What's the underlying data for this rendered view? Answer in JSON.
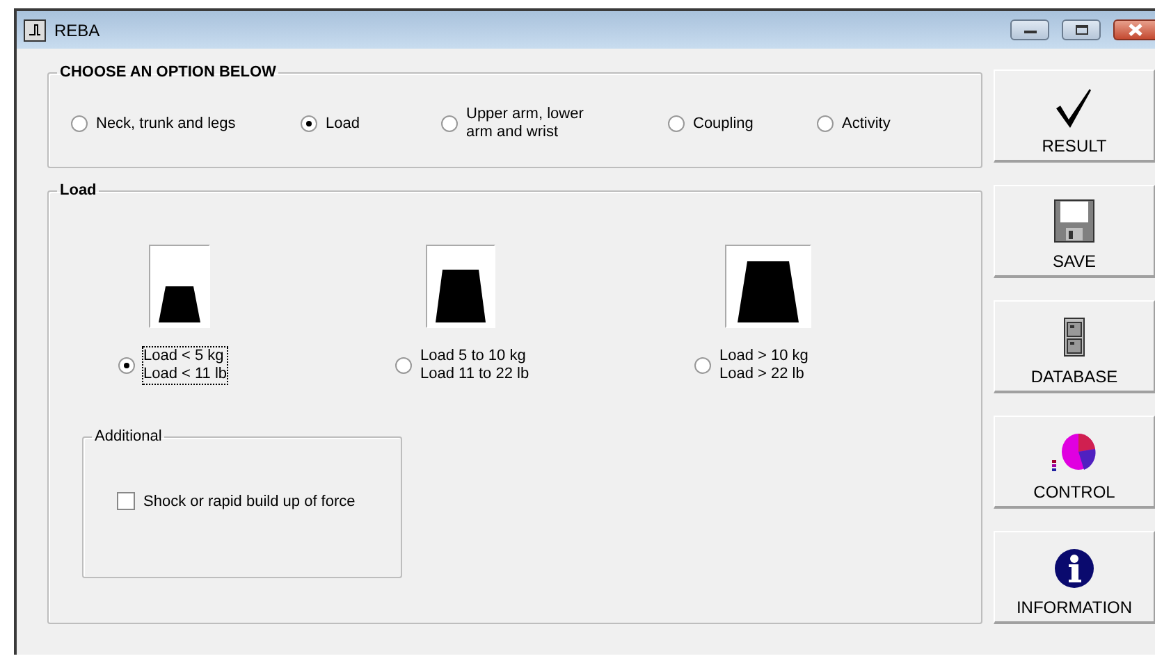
{
  "window": {
    "title": "REBA"
  },
  "options_group": {
    "title": "CHOOSE AN OPTION BELOW",
    "options": [
      {
        "label": "Neck, trunk and legs",
        "selected": false
      },
      {
        "label": "Load",
        "selected": true
      },
      {
        "label": "Upper arm, lower\narm and wrist",
        "selected": false
      },
      {
        "label": "Coupling",
        "selected": false
      },
      {
        "label": "Activity",
        "selected": false
      }
    ]
  },
  "load_group": {
    "title": "Load",
    "options": [
      {
        "kind": "small",
        "label": "Load < 5 kg\nLoad < 11 lb",
        "selected": true
      },
      {
        "kind": "medium",
        "label": "Load 5 to 10 kg\nLoad 11 to 22 lb",
        "selected": false
      },
      {
        "kind": "large",
        "label": "Load > 10 kg\nLoad > 22 lb",
        "selected": false
      }
    ],
    "additional": {
      "title": "Additional",
      "checkbox": {
        "label": "Shock or rapid build up of force",
        "checked": false
      }
    }
  },
  "side_buttons": [
    {
      "kind": "check",
      "label": "RESULT"
    },
    {
      "kind": "floppy",
      "label": "SAVE"
    },
    {
      "kind": "cabinet",
      "label": "DATABASE"
    },
    {
      "kind": "pie",
      "label": "CONTROL"
    },
    {
      "kind": "info",
      "label": "INFORMATION"
    }
  ]
}
